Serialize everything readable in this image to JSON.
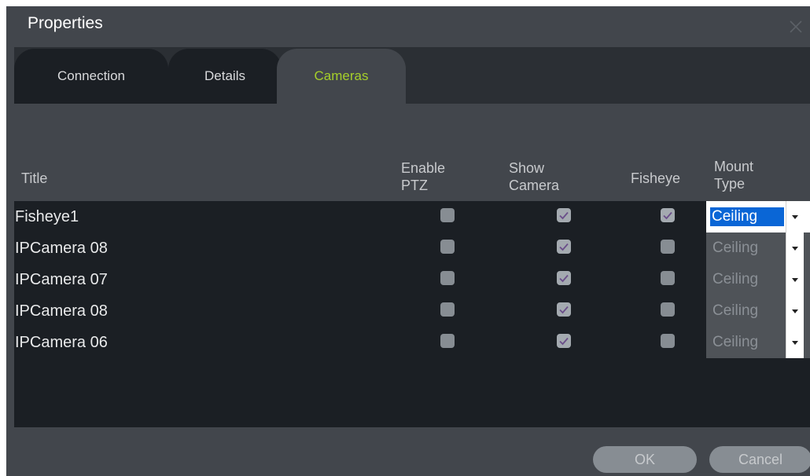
{
  "window": {
    "title": "Properties",
    "close_icon": "close-icon"
  },
  "tabs": [
    {
      "label": "Connection",
      "active": false
    },
    {
      "label": "Details",
      "active": false
    },
    {
      "label": "Cameras",
      "active": true
    }
  ],
  "table": {
    "columns": {
      "title": "Title",
      "enable_ptz": [
        "Enable",
        "PTZ"
      ],
      "show_camera": [
        "Show",
        "Camera"
      ],
      "fisheye": "Fisheye",
      "mount_type": [
        "Mount",
        "Type"
      ]
    },
    "rows": [
      {
        "title": "Fisheye1",
        "enable_ptz": false,
        "show_camera": true,
        "fisheye": true,
        "mount_type": "Ceiling",
        "selected": true
      },
      {
        "title": "IPCamera 08",
        "enable_ptz": false,
        "show_camera": true,
        "fisheye": false,
        "mount_type": "Ceiling"
      },
      {
        "title": "IPCamera 07",
        "enable_ptz": false,
        "show_camera": true,
        "fisheye": false,
        "mount_type": "Ceiling"
      },
      {
        "title": "IPCamera 08",
        "enable_ptz": false,
        "show_camera": true,
        "fisheye": false,
        "mount_type": "Ceiling"
      },
      {
        "title": "IPCamera 06",
        "enable_ptz": false,
        "show_camera": true,
        "fisheye": false,
        "mount_type": "Ceiling"
      }
    ]
  },
  "buttons": {
    "ok": "OK",
    "cancel": "Cancel"
  },
  "colors": {
    "dialog_bg": "#42464c",
    "panel_bg": "#1b1f24",
    "active_tab_text": "#a5cf2a",
    "selection": "#0a66d6",
    "checkmark": "#6b4f8a"
  }
}
